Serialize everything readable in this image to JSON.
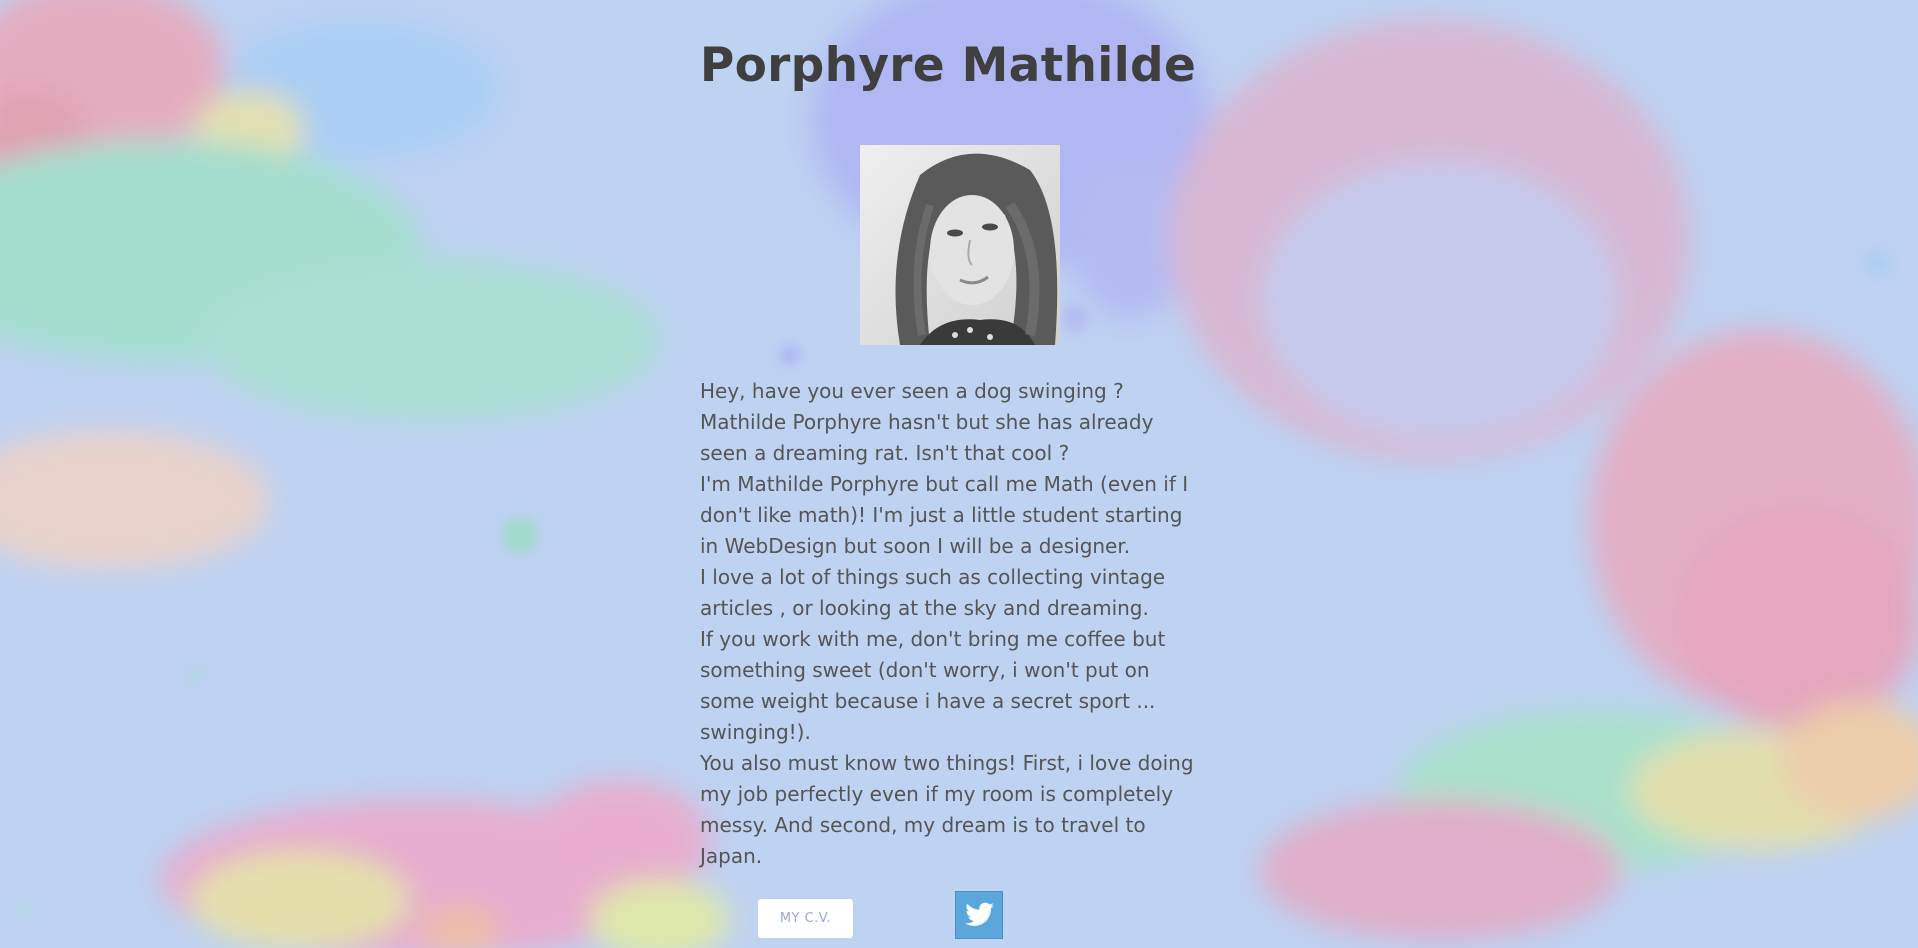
{
  "page": {
    "title": "Porphyre Mathilde",
    "background_color": "#bed2f2"
  },
  "portrait": {
    "icon": "portrait-photo",
    "style": "grayscale"
  },
  "bio": {
    "paragraphs": [
      "Hey, have you ever seen a dog swinging ?",
      "Mathilde Porphyre hasn't but she has already seen a dreaming rat. Isn't that cool ?",
      "I'm Mathilde Porphyre but call me Math (even if I don't like math)! I'm just a little student starting in WebDesign but soon I will be a designer.",
      "I love a lot of things such as collecting vintage articles , or looking at the sky and dreaming.",
      "If you work with me, don't bring me coffee but something sweet (don't worry, i won't put on some weight because i have a secret sport ... swinging!).",
      "You also must know two things! First, i love doing my job perfectly even if my room is completely messy. And second, my dream is to travel to Japan."
    ]
  },
  "links": {
    "cv_label": "MY C.V.",
    "twitter_icon": "twitter-bird",
    "twitter_color": "#5aa7dd"
  }
}
